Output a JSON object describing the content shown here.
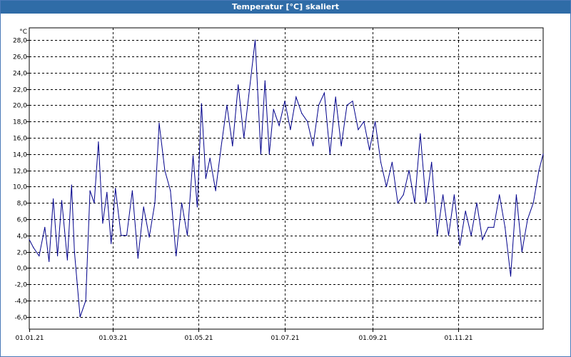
{
  "window": {
    "title": "Temperatur [°C] skaliert"
  },
  "chart_data": {
    "type": "line",
    "title": "Temperatur [°C] skaliert",
    "ylabel": "°C",
    "xlabel": "",
    "ylim": [
      -7.5,
      29.5
    ],
    "yticks": [
      28,
      26,
      24,
      22,
      20,
      18,
      16,
      14,
      12,
      10,
      8,
      6,
      4,
      2,
      0,
      -2,
      -4,
      -6
    ],
    "ytick_labels": [
      "28,0",
      "26,0",
      "24,0",
      "22,0",
      "20,0",
      "18,0",
      "16,0",
      "14,0",
      "12,0",
      "10,0",
      "8,0",
      "6,0",
      "4,0",
      "2,0",
      "0,0",
      "-2,0",
      "-4,0",
      "-6,0"
    ],
    "xlim": [
      "01.01.21",
      "31.12.21"
    ],
    "xtick_labels": [
      "01.01.21",
      "01.03.21",
      "01.05.21",
      "01.07.21",
      "01.09.21",
      "01.11.21"
    ],
    "grid": true,
    "line_color": "#00008b",
    "series": [
      {
        "x": [
          "01.01.21",
          "04.01.21",
          "08.01.21",
          "12.01.21",
          "15.01.21",
          "18.01.21",
          "21.01.21",
          "24.01.21",
          "28.01.21",
          "31.01.21",
          "02.02.21",
          "06.02.21",
          "10.02.21",
          "13.02.21",
          "16.02.21",
          "19.02.21",
          "22.02.21",
          "25.02.21",
          "28.02.21",
          "03.03.21",
          "07.03.21",
          "11.03.21",
          "15.03.21",
          "19.03.21",
          "23.03.21",
          "27.03.21",
          "31.03.21",
          "03.04.21",
          "07.04.21",
          "11.04.21",
          "15.04.21",
          "19.04.21",
          "23.04.21",
          "27.04.21",
          "30.04.21",
          "03.05.21",
          "06.05.21",
          "09.05.21",
          "13.05.21",
          "17.05.21",
          "21.05.21",
          "25.05.21",
          "29.05.21",
          "02.06.21",
          "06.06.21",
          "10.06.21",
          "14.06.21",
          "17.06.21",
          "20.06.21",
          "23.06.21",
          "27.06.21",
          "01.07.21",
          "05.07.21",
          "09.07.21",
          "13.07.21",
          "17.07.21",
          "21.07.21",
          "25.07.21",
          "29.07.21",
          "02.08.21",
          "06.08.21",
          "10.08.21",
          "14.08.21",
          "18.08.21",
          "22.08.21",
          "26.08.21",
          "30.08.21",
          "03.09.21",
          "07.09.21",
          "11.09.21",
          "15.09.21",
          "19.09.21",
          "23.09.21",
          "27.09.21",
          "01.10.21",
          "05.10.21",
          "09.10.21",
          "13.10.21",
          "17.10.21",
          "21.10.21",
          "25.10.21",
          "29.10.21",
          "02.11.21",
          "06.11.21",
          "10.11.21",
          "14.11.21",
          "18.11.21",
          "22.11.21",
          "26.11.21",
          "30.11.21",
          "04.12.21",
          "08.12.21",
          "12.12.21",
          "16.12.21",
          "20.12.21",
          "24.12.21",
          "28.12.21",
          "31.12.21"
        ],
        "y": [
          3.5,
          2.5,
          1.5,
          5.0,
          0.8,
          8.5,
          1.5,
          8.3,
          1.0,
          10.2,
          2.0,
          -6.0,
          -4.0,
          9.5,
          8.0,
          15.5,
          5.5,
          9.3,
          3.0,
          9.8,
          4.0,
          4.0,
          9.5,
          1.2,
          7.5,
          3.8,
          8.0,
          17.8,
          12.0,
          9.5,
          1.5,
          8.0,
          4.0,
          13.8,
          7.5,
          20.2,
          11.0,
          13.5,
          9.5,
          15.0,
          20.0,
          15.0,
          22.5,
          16.0,
          22.0,
          28.0,
          14.0,
          23.0,
          14.0,
          19.5,
          17.5,
          20.5,
          17.0,
          21.0,
          19.0,
          18.0,
          15.0,
          20.0,
          21.5,
          14.0,
          21.0,
          15.0,
          20.0,
          20.5,
          17.0,
          18.0,
          14.5,
          18.0,
          13.0,
          10.0,
          13.0,
          8.0,
          9.0,
          12.0,
          8.0,
          16.5,
          8.0,
          13.0,
          4.0,
          9.0,
          4.0,
          9.0,
          2.8,
          7.0,
          4.0,
          8.0,
          3.5,
          5.0,
          5.0,
          9.0,
          5.0,
          -1.0,
          9.0,
          2.0,
          6.0,
          8.0,
          12.0,
          14.0
        ]
      }
    ]
  }
}
